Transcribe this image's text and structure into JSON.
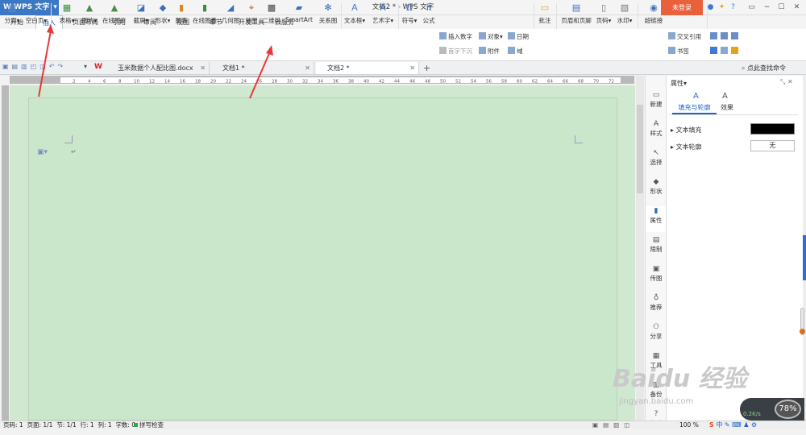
{
  "titlebar": {
    "app": "W WPS 文字",
    "title": "文档2 * - WPS 文字",
    "login": "未登录",
    "icons": [
      "skin-icon",
      "gift-icon",
      "help-icon",
      "minimize-icon",
      "maximize-icon",
      "close-icon"
    ]
  },
  "menu": {
    "tabs": [
      "开始",
      "插入",
      "页面布局",
      "引用",
      "审阅",
      "视图",
      "章节",
      "开发工具",
      "云服务"
    ],
    "active": "插入"
  },
  "ribbon": {
    "big": [
      {
        "label": "分页▾",
        "icon": "page-break-icon"
      },
      {
        "label": "空白页▾",
        "icon": "blank-page-icon"
      },
      {
        "label": "表格▾",
        "icon": "table-icon"
      },
      {
        "label": "图片▾",
        "icon": "picture-icon"
      },
      {
        "label": "在线图片",
        "icon": "online-picture-icon"
      },
      {
        "label": "截屏▾",
        "icon": "screenshot-icon"
      },
      {
        "label": "形状▾",
        "icon": "shape-icon"
      },
      {
        "label": "图表",
        "icon": "chart-icon"
      },
      {
        "label": "在线图表",
        "icon": "online-chart-icon"
      },
      {
        "label": "几何图",
        "icon": "geometry-icon"
      },
      {
        "label": "地图",
        "icon": "map-icon"
      },
      {
        "label": "二维码",
        "icon": "qrcode-icon"
      },
      {
        "label": "SmartArt",
        "icon": "smartart-icon"
      },
      {
        "label": "关系图",
        "icon": "relation-icon"
      },
      {
        "label": "文本框▾",
        "icon": "textbox-icon"
      },
      {
        "label": "艺术字▾",
        "icon": "wordart-icon"
      },
      {
        "label": "符号▾",
        "icon": "symbol-icon"
      },
      {
        "label": "公式",
        "icon": "formula-icon"
      }
    ],
    "small": {
      "insert_number": "插入数字",
      "object": "对象▾",
      "date": "日期",
      "drop_cap": "首字下沉",
      "attachment": "附件",
      "field": "域"
    },
    "right": [
      {
        "label": "批注",
        "icon": "comment-icon"
      },
      {
        "label": "页眉和页脚",
        "icon": "header-footer-icon"
      },
      {
        "label": "页码▾",
        "icon": "page-number-icon"
      },
      {
        "label": "水印▾",
        "icon": "watermark-icon"
      },
      {
        "label": "超链接",
        "icon": "hyperlink-icon"
      }
    ],
    "right_small": {
      "cross_ref": "交叉引用",
      "bookmark": "书签"
    }
  },
  "doc_tabs": [
    {
      "label": "玉米数据个人配比图.docx",
      "active": false
    },
    {
      "label": "文档1 *",
      "active": false
    },
    {
      "label": "文档2 *",
      "active": true
    }
  ],
  "search_cmd": "点此查找命令",
  "ruler": {
    "marks": [
      "2",
      "4",
      "6",
      "8",
      "10",
      "12",
      "14",
      "16",
      "18",
      "20",
      "22",
      "24",
      "26",
      "28",
      "30",
      "32",
      "34",
      "36",
      "38",
      "40",
      "42",
      "44",
      "46",
      "48",
      "50",
      "52",
      "54",
      "56",
      "58",
      "60",
      "62",
      "64",
      "66",
      "68",
      "70",
      "72"
    ]
  },
  "side_tools": [
    "新建",
    "样式",
    "选择",
    "形状",
    "属性",
    "限制",
    "传图",
    "推荐",
    "分享",
    "工具",
    "备份",
    "帮助"
  ],
  "panel": {
    "title": "属性▾",
    "tabs": [
      "填充与轮廓",
      "效果"
    ],
    "active_tab": "填充与轮廓",
    "rows": [
      {
        "label": "文本填充",
        "value": "",
        "swatch": "#000000"
      },
      {
        "label": "文本轮廓",
        "value": "无"
      }
    ]
  },
  "status": {
    "page": "页码: 1",
    "pages": "页面: 1/1",
    "section": "节: 1/1",
    "line": "行: 1",
    "col": "列: 1",
    "words": "字数: 0",
    "spell": "拼写检查",
    "zoom": "100 %"
  },
  "tray": {
    "ime": "中",
    "speed": "78%",
    "net": "0.2K/s"
  },
  "watermark": {
    "main": "Baidu 经验",
    "sub": "jingyan.baidu.com"
  },
  "colors": {
    "accent": "#1b63c6",
    "page_bg": "#cbe7cb",
    "arrow": "#e53935",
    "login": "#e8603c"
  }
}
